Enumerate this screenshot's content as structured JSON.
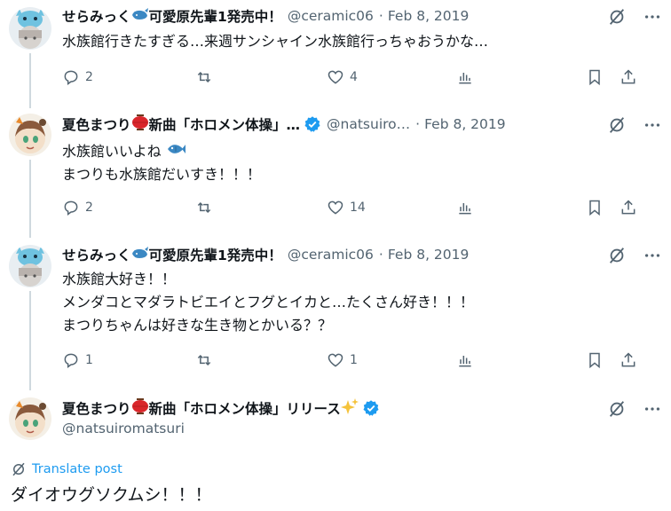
{
  "tweets": [
    {
      "name": "せらみっく",
      "name_suffix": "可愛原先輩1発売中！",
      "handle": "@ceramic06",
      "date": "Feb 8, 2019",
      "lines": [
        "水族館行きたすぎる…来週サンシャイン水族館行っちゃおうかな…"
      ],
      "replies": "2",
      "retweets": "",
      "likes": "4"
    },
    {
      "name": "夏色まつり",
      "name_suffix": "新曲「ホロメン体操」…",
      "handle": "@natsuiro…",
      "date": "Feb 8, 2019",
      "lines": [
        "水族館いいよね",
        "まつりも水族館だいすき！！！"
      ],
      "replies": "2",
      "retweets": "",
      "likes": "14"
    },
    {
      "name": "せらみっく",
      "name_suffix": "可愛原先輩1発売中！",
      "handle": "@ceramic06",
      "date": "Feb 8, 2019",
      "lines": [
        "水族館大好き！！",
        "メンダコとマダラトビエイとフグとイカと…たくさん好き！！！",
        "まつりちゃんは好きな生き物とかいる？？"
      ],
      "replies": "1",
      "retweets": "",
      "likes": "1"
    }
  ],
  "main_tweet": {
    "name": "夏色まつり",
    "name_suffix": "新曲「ホロメン体操」リリース",
    "handle": "@natsuiromatsuri",
    "translate_label": "Translate post",
    "text": "ダイオウグソクムシ！！！"
  },
  "colors": {
    "accent": "#1d9bf0",
    "muted": "#536471",
    "text": "#0f1419"
  },
  "icons": [
    "grok-icon",
    "more-icon",
    "reply-icon",
    "retweet-icon",
    "like-icon",
    "views-icon",
    "bookmark-icon",
    "share-icon",
    "whale-icon",
    "fish-icon",
    "red-lantern-icon",
    "sparkles-icon",
    "verified-icon"
  ]
}
